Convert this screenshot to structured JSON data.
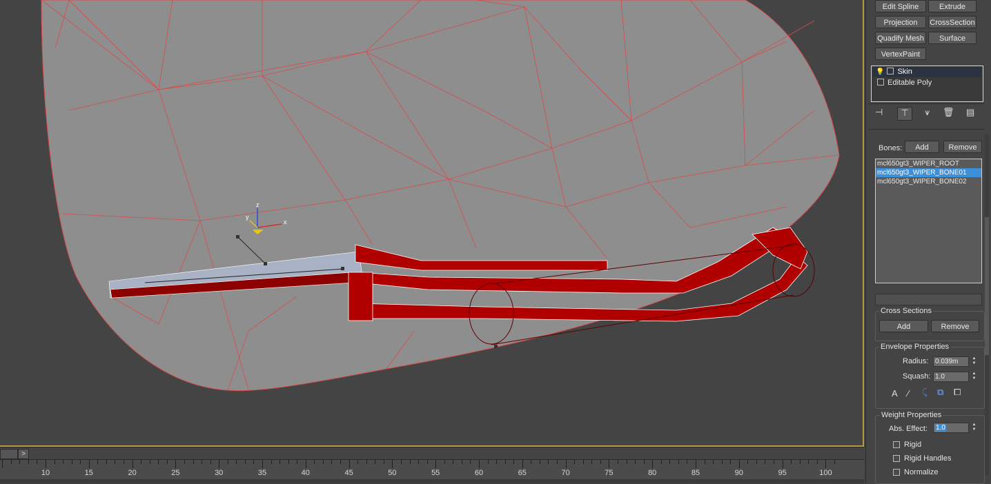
{
  "modifier_buttons": [
    {
      "label": "Edit Spline"
    },
    {
      "label": "Extrude"
    },
    {
      "label": "Projection"
    },
    {
      "label": "CrossSection"
    },
    {
      "label": "Quadify Mesh"
    },
    {
      "label": "Surface"
    },
    {
      "label": "VertexPaint"
    }
  ],
  "modifier_stack": [
    {
      "label": "Skin",
      "selected": true
    },
    {
      "label": "Editable Poly",
      "selected": false
    }
  ],
  "stack_toolbar_icons": [
    "pin-stack-icon",
    "show-end-result-icon",
    "make-unique-icon",
    "remove-modifier-icon",
    "configure-sets-icon"
  ],
  "bones": {
    "label": "Bones:",
    "add_label": "Add",
    "remove_label": "Remove",
    "items": [
      {
        "name": "mcl650gt3_WIPER_ROOT",
        "selected": false
      },
      {
        "name": "mcl650gt3_WIPER_BONE01",
        "selected": true
      },
      {
        "name": "mcl650gt3_WIPER_BONE02",
        "selected": false
      }
    ],
    "name_field": ""
  },
  "cross_sections": {
    "title": "Cross Sections",
    "add_label": "Add",
    "remove_label": "Remove"
  },
  "envelope": {
    "title": "Envelope Properties",
    "radius_label": "Radius:",
    "radius_value": "0.039m",
    "squash_label": "Squash:",
    "squash_value": "1.0",
    "icons": [
      "absolute-envelope-icon",
      "relative-envelope-icon",
      "falloff-curve-icon",
      "copy-envelope-icon",
      "paste-envelope-icon"
    ]
  },
  "weight": {
    "title": "Weight Properties",
    "abs_effect_label": "Abs. Effect:",
    "abs_effect_value": "1.0",
    "rigid_label": "Rigid",
    "rigid_handles_label": "Rigid Handles",
    "normalize_label": "Normalize"
  },
  "timeline": {
    "next_label": ">",
    "ruler_labels": [
      "10",
      "15",
      "20",
      "25",
      "30",
      "35",
      "40",
      "45",
      "50",
      "55",
      "60",
      "65",
      "70",
      "75",
      "80",
      "85",
      "90",
      "95",
      "100"
    ]
  },
  "gizmo": {
    "x": "x",
    "y": "y",
    "z": "z"
  },
  "colors": {
    "viewport_bg": "#444444",
    "mesh_fill": "#8e8e8e",
    "wire": "#e05050",
    "selection_red": "#c00000",
    "accent_blue": "#3d8fd8",
    "border_gold": "#b89a3a"
  }
}
